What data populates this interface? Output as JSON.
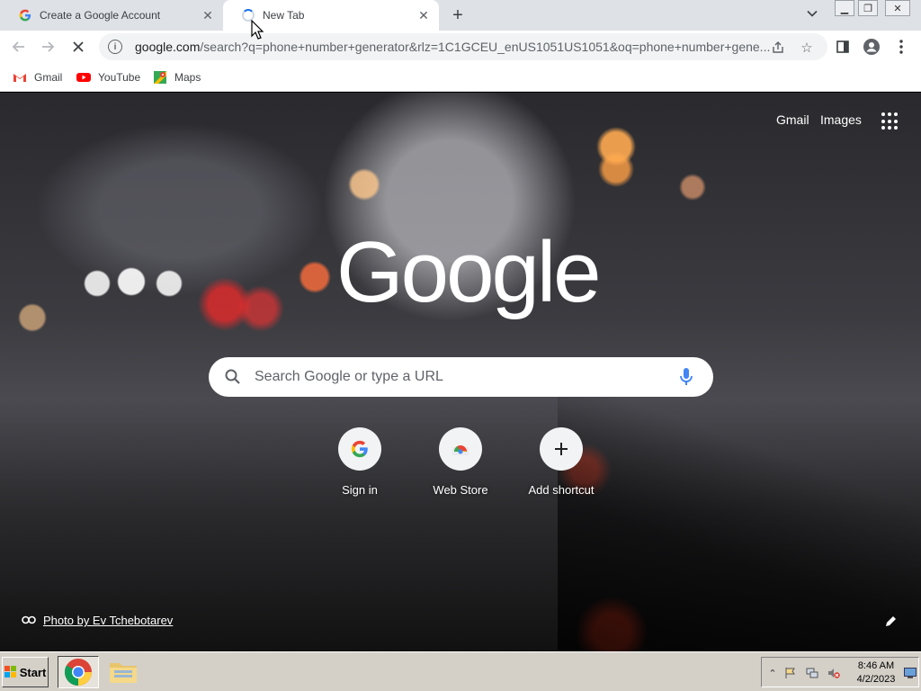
{
  "tabs": [
    {
      "title": "Create a Google Account",
      "favicon": "google-g-icon"
    },
    {
      "title": "New Tab",
      "favicon": "loading-spinner-icon",
      "active": true
    }
  ],
  "toolbar": {
    "url_host": "google.com",
    "url_rest": "/search?q=phone+number+generator&rlz=1C1GCEU_enUS1051US1051&oq=phone+number+gene..."
  },
  "bookmarks": [
    {
      "label": "Gmail",
      "icon": "gmail-icon"
    },
    {
      "label": "YouTube",
      "icon": "youtube-icon"
    },
    {
      "label": "Maps",
      "icon": "maps-icon"
    }
  ],
  "ntp": {
    "gmail_link": "Gmail",
    "images_link": "Images",
    "logo_text": "Google",
    "search_placeholder": "Search Google or type a URL",
    "shortcuts": [
      {
        "label": "Sign in",
        "icon": "google-g-icon"
      },
      {
        "label": "Web Store",
        "icon": "web-store-icon"
      },
      {
        "label": "Add shortcut",
        "icon": "plus-icon"
      }
    ],
    "photo_credit": "Photo by Ev Tchebotarev"
  },
  "taskbar": {
    "start_label": "Start",
    "clock_time": "8:46 AM",
    "clock_date": "4/2/2023"
  },
  "colors": {
    "google_blue": "#4285f4",
    "google_red": "#ea4335",
    "google_yellow": "#fbbc05",
    "google_green": "#34a853"
  }
}
